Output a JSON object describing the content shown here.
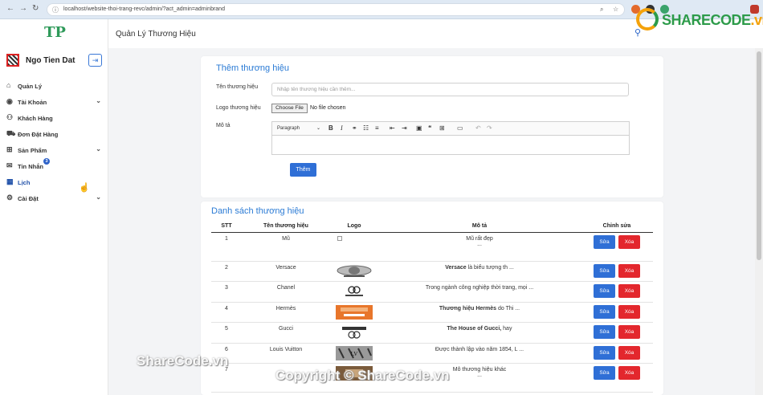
{
  "browser": {
    "url": "localhost/website-thoi-trang-revc/admin/?act_admin=adminbrand"
  },
  "watermark": {
    "logo_main": "SHARECODE",
    "logo_suffix": ".vn",
    "text1": "ShareCode.vn",
    "text2": "Copyright © ShareCode.vn"
  },
  "sidebar": {
    "brand": "TP",
    "user_name": "Ngo Tien Dat",
    "items": [
      {
        "label": "Quản Lý",
        "icon": "home-icon",
        "chevron": false
      },
      {
        "label": "Tài Khoản",
        "icon": "user-circle-icon",
        "chevron": true
      },
      {
        "label": "Khách Hàng",
        "icon": "person-icon",
        "chevron": false
      },
      {
        "label": "Đơn Đặt Hàng",
        "icon": "cart-icon",
        "chevron": false
      },
      {
        "label": "Sản Phẩm",
        "icon": "grid-icon",
        "chevron": true
      },
      {
        "label": "Tin Nhắn",
        "icon": "message-icon",
        "chevron": false,
        "badge": "3"
      },
      {
        "label": "Lịch",
        "icon": "calendar-icon",
        "chevron": false
      },
      {
        "label": "Cài Đặt",
        "icon": "gear-icon",
        "chevron": true
      }
    ]
  },
  "header": {
    "title": "Quản Lý Thương Hiệu"
  },
  "add_form": {
    "title": "Thêm thương hiệu",
    "name_label": "Tên thương hiệu",
    "name_placeholder": "Nhập tên thương hiệu cần thêm...",
    "logo_label": "Logo thương hiệu",
    "file_button": "Choose File",
    "file_status": "No file chosen",
    "desc_label": "Mô tả",
    "editor_style": "Paragraph",
    "submit": "Thêm"
  },
  "list": {
    "title": "Danh sách thương hiệu",
    "columns": [
      "STT",
      "Tên thương hiệu",
      "Logo",
      "Mô tả",
      "Chỉnh sửa"
    ],
    "edit_label": "Sửa",
    "delete_label": "Xóa",
    "rows": [
      {
        "stt": "1",
        "name": "Mũ",
        "logo": "broken",
        "desc_bold": "",
        "desc": "Mũ rất đẹp",
        "extra": "..."
      },
      {
        "stt": "2",
        "name": "Versace",
        "logo": "versace",
        "desc_bold": "Versace",
        "desc": " là biểu tượng th ...",
        "extra": ""
      },
      {
        "stt": "3",
        "name": "Chanel",
        "logo": "chanel",
        "desc_bold": "",
        "desc": "Trong ngành công nghiệp thời trang, mọi ...",
        "extra": ""
      },
      {
        "stt": "4",
        "name": "Hermès",
        "logo": "hermes",
        "desc_bold": "Thương hiệu Hermès",
        "desc": " do Thi ...",
        "extra": ""
      },
      {
        "stt": "5",
        "name": "Gucci",
        "logo": "gucci",
        "desc_bold": "The House of Gucci,",
        "desc": " hay",
        "extra": ""
      },
      {
        "stt": "6",
        "name": "Louis Vuitton",
        "logo": "lv",
        "desc_bold": "",
        "desc": "Được thành lập vào năm 1854, L ...",
        "extra": ""
      },
      {
        "stt": "7",
        "name": "",
        "logo": "other",
        "desc_bold": "",
        "desc": "Mô thương hiệu khác",
        "extra": "..."
      }
    ]
  },
  "colors": {
    "accent": "#2b7bd5",
    "primary_button": "#2f6fd6",
    "danger_button": "#e3272d",
    "brand_green": "#2f9a5a"
  }
}
